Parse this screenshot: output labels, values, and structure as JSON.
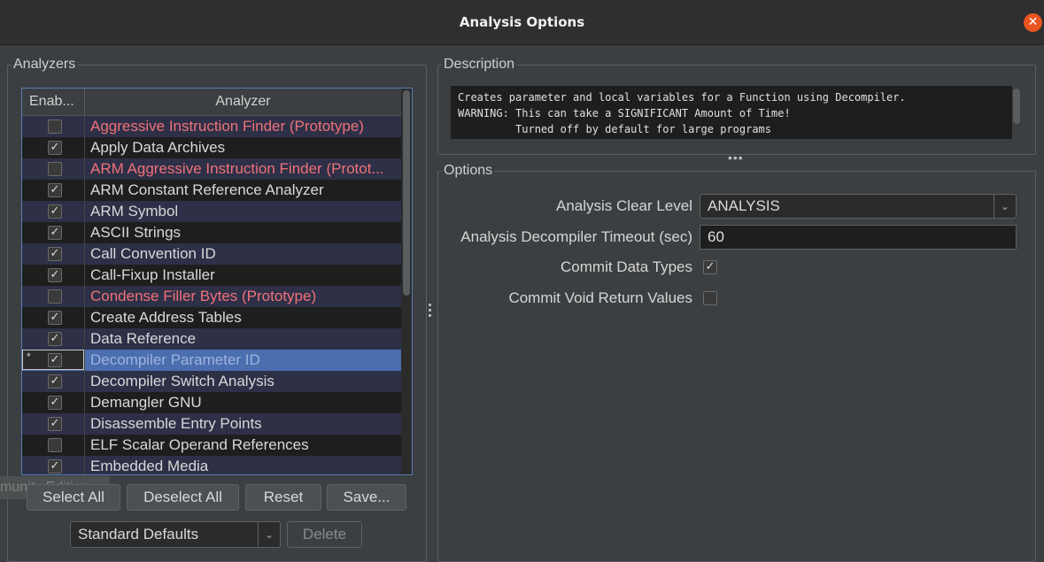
{
  "window": {
    "title": "Analysis Options",
    "close_glyph": "✕"
  },
  "analyzers_panel": {
    "title": "Analyzers",
    "columns": {
      "enabled": "Enab...",
      "analyzer": "Analyzer"
    },
    "rows": [
      {
        "label": "Aggressive Instruction Finder (Prototype)",
        "checked": false,
        "prototype": true,
        "mark": ""
      },
      {
        "label": "Apply Data Archives",
        "checked": true,
        "prototype": false,
        "mark": ""
      },
      {
        "label": "ARM Aggressive Instruction Finder (Protot...",
        "checked": false,
        "prototype": true,
        "mark": ""
      },
      {
        "label": "ARM Constant Reference Analyzer",
        "checked": true,
        "prototype": false,
        "mark": ""
      },
      {
        "label": "ARM Symbol",
        "checked": true,
        "prototype": false,
        "mark": ""
      },
      {
        "label": "ASCII Strings",
        "checked": true,
        "prototype": false,
        "mark": ""
      },
      {
        "label": "Call Convention ID",
        "checked": true,
        "prototype": false,
        "mark": ""
      },
      {
        "label": "Call-Fixup Installer",
        "checked": true,
        "prototype": false,
        "mark": ""
      },
      {
        "label": "Condense Filler Bytes (Prototype)",
        "checked": false,
        "prototype": true,
        "mark": ""
      },
      {
        "label": "Create Address Tables",
        "checked": true,
        "prototype": false,
        "mark": ""
      },
      {
        "label": "Data Reference",
        "checked": true,
        "prototype": false,
        "mark": ""
      },
      {
        "label": "Decompiler Parameter ID",
        "checked": true,
        "prototype": false,
        "mark": "*",
        "selected": true
      },
      {
        "label": "Decompiler Switch Analysis",
        "checked": true,
        "prototype": false,
        "mark": ""
      },
      {
        "label": "Demangler GNU",
        "checked": true,
        "prototype": false,
        "mark": ""
      },
      {
        "label": "Disassemble Entry Points",
        "checked": true,
        "prototype": false,
        "mark": ""
      },
      {
        "label": "ELF Scalar Operand References",
        "checked": false,
        "prototype": false,
        "mark": ""
      },
      {
        "label": "Embedded Media",
        "checked": true,
        "prototype": false,
        "mark": ""
      }
    ],
    "buttons": {
      "select_all": "Select All",
      "deselect_all": "Deselect All",
      "reset": "Reset",
      "save": "Save..."
    },
    "profile": {
      "selected": "Standard Defaults",
      "delete": "Delete"
    },
    "watermark": "munity Edition"
  },
  "description_panel": {
    "title": "Description",
    "lines": [
      "Creates parameter and local variables for a Function using Decompiler.",
      "WARNING: This can take a SIGNIFICANT Amount of Time!",
      "         Turned off by default for large programs"
    ]
  },
  "options_panel": {
    "title": "Options",
    "clear_level": {
      "label": "Analysis Clear Level",
      "value": "ANALYSIS"
    },
    "timeout": {
      "label": "Analysis Decompiler Timeout (sec)",
      "value": "60"
    },
    "commit_types": {
      "label": "Commit Data Types",
      "checked": true
    },
    "commit_void": {
      "label": "Commit Void Return Values",
      "checked": false
    }
  },
  "colors": {
    "prototype_text": "#f07178",
    "selection": "#4b6eaf",
    "close_button": "#e95420"
  }
}
